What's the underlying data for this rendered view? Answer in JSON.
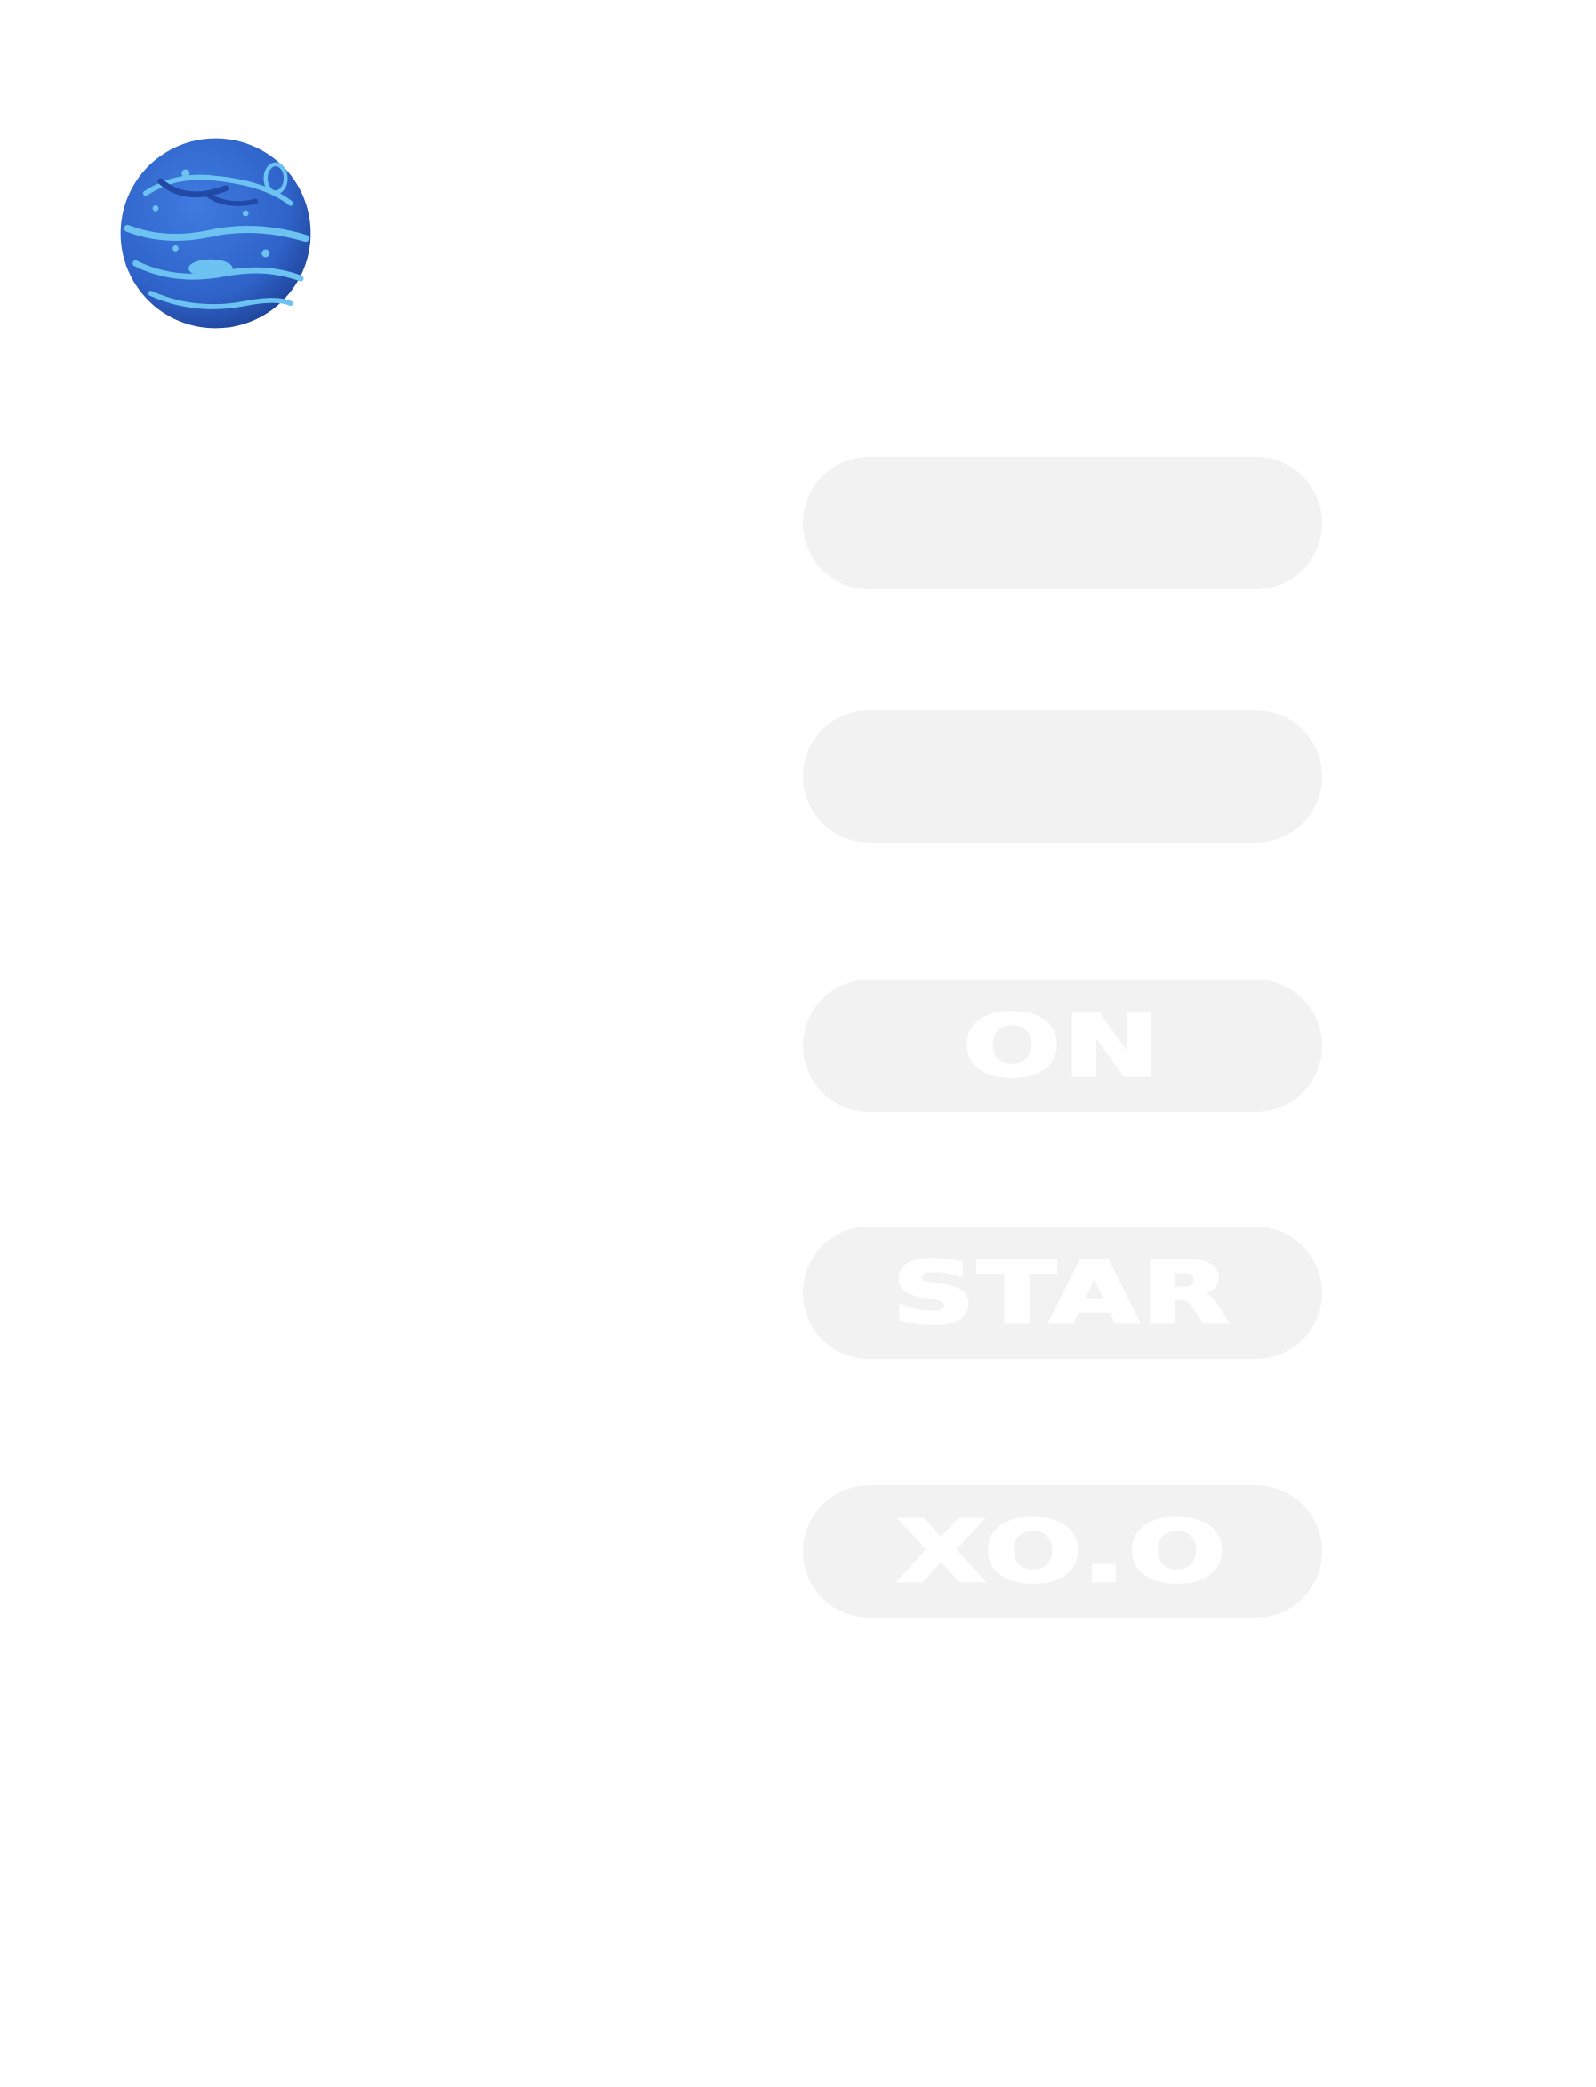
{
  "logo": {
    "icon": "planet-icon",
    "colors": {
      "base": "#2f63c9",
      "shadow": "#2249a6",
      "highlight": "#6cc3f2"
    }
  },
  "menu": {
    "buttons": [
      {
        "label": ""
      },
      {
        "label": ""
      },
      {
        "label": "ON"
      },
      {
        "label": "STAR"
      },
      {
        "label": "XO.O"
      }
    ],
    "colors": {
      "pill_bg": "#f2f2f2",
      "label": "#ffffff"
    }
  }
}
